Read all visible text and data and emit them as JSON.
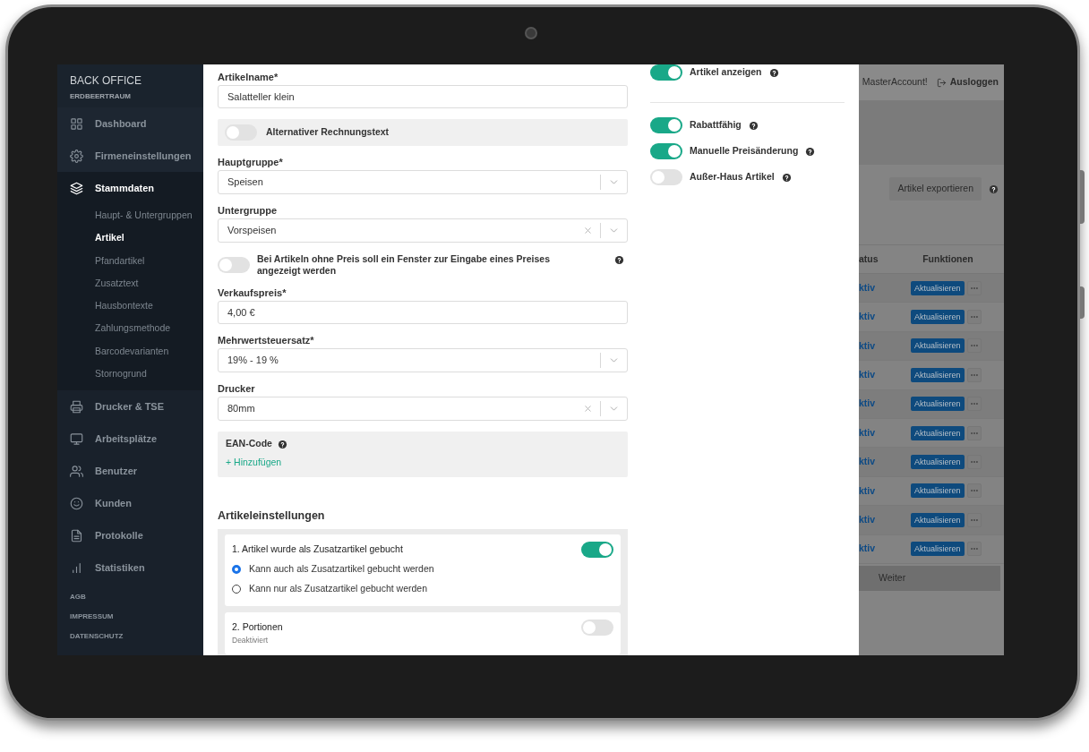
{
  "sidebar": {
    "title": "BACK OFFICE",
    "subtitle": "ERDBEERTRAUM",
    "items": [
      {
        "label": "Dashboard",
        "selected": false
      },
      {
        "label": "Firmeneinstellungen",
        "selected": false
      },
      {
        "label": "Stammdaten",
        "selected": true,
        "children": [
          {
            "label": "Haupt- & Untergruppen",
            "selected": false
          },
          {
            "label": "Artikel",
            "selected": true
          },
          {
            "label": "Pfandartikel",
            "selected": false
          },
          {
            "label": "Zusatztext",
            "selected": false
          },
          {
            "label": "Hausbontexte",
            "selected": false
          },
          {
            "label": "Zahlungsmethode",
            "selected": false
          },
          {
            "label": "Barcodevarianten",
            "selected": false
          },
          {
            "label": "Stornogrund",
            "selected": false
          }
        ]
      },
      {
        "label": "Drucker & TSE",
        "selected": false
      },
      {
        "label": "Arbeitsplätze",
        "selected": false
      },
      {
        "label": "Benutzer",
        "selected": false
      },
      {
        "label": "Kunden",
        "selected": false
      },
      {
        "label": "Protokolle",
        "selected": false
      },
      {
        "label": "Statistiken",
        "selected": false
      }
    ],
    "footer_links": [
      "AGB",
      "IMPRESSUM",
      "DATENSCHUTZ"
    ]
  },
  "dialog": {
    "fields": [
      {
        "kind": "input",
        "label": "Artikelname*",
        "value": "Salatteller klein"
      },
      {
        "kind": "toggle_box",
        "label": "Alternativer Rechnungstext",
        "on": false
      },
      {
        "kind": "select",
        "label": "Hauptgruppe*",
        "value": "Speisen",
        "clearable": false
      },
      {
        "kind": "select",
        "label": "Untergruppe",
        "value": "Vorspeisen",
        "clearable": true
      },
      {
        "kind": "toggle",
        "label": "Bei Artikeln ohne Preis soll ein Fenster zur Eingabe eines Preises angezeigt werden",
        "on": false,
        "help": true
      },
      {
        "kind": "input",
        "label": "Verkaufspreis*",
        "value": "4,00 €"
      },
      {
        "kind": "select",
        "label": "Mehrwertsteuersatz*",
        "value": "19% - 19 %",
        "clearable": false
      },
      {
        "kind": "select",
        "label": "Drucker",
        "value": "80mm",
        "clearable": true
      },
      {
        "kind": "ean",
        "label": "EAN-Code",
        "help": true,
        "link": "+ Hinzufügen"
      }
    ],
    "settings": {
      "heading": "Artikeleinstellungen",
      "cards": [
        {
          "title": "1. Artikel wurde als Zusatzartikel gebucht",
          "on": true,
          "options": [
            {
              "label": "Kann auch als Zusatzartikel gebucht werden",
              "selected": true
            },
            {
              "label": "Kann nur als Zusatzartikel gebucht werden",
              "selected": false
            }
          ]
        },
        {
          "title": "2. Portionen",
          "on": false,
          "subtitle": "Deaktiviert"
        }
      ]
    },
    "right_toggle_groups": [
      [
        {
          "label": "Artikel anzeigen",
          "on": true,
          "help": true
        }
      ],
      [
        {
          "label": "Rabattfähig",
          "on": true,
          "help": true
        },
        {
          "label": "Manuelle Preisänderung",
          "on": true,
          "help": true
        },
        {
          "label": "Außer-Haus Artikel",
          "on": false,
          "help": true
        }
      ]
    ]
  },
  "background": {
    "greeting": "MasterAccount!",
    "logout": "Ausloggen",
    "export_button": "Artikel exportieren",
    "table": {
      "columns": [
        "atus",
        "Funktionen"
      ],
      "rows": [
        {
          "status": "ktiv",
          "action": "Aktualisieren"
        },
        {
          "status": "ktiv",
          "action": "Aktualisieren"
        },
        {
          "status": "ktiv",
          "action": "Aktualisieren"
        },
        {
          "status": "ktiv",
          "action": "Aktualisieren"
        },
        {
          "status": "ktiv",
          "action": "Aktualisieren"
        },
        {
          "status": "ktiv",
          "action": "Aktualisieren"
        },
        {
          "status": "ktiv",
          "action": "Aktualisieren"
        },
        {
          "status": "ktiv",
          "action": "Aktualisieren"
        },
        {
          "status": "ktiv",
          "action": "Aktualisieren"
        },
        {
          "status": "ktiv",
          "action": "Aktualisieren"
        }
      ]
    },
    "next_button": "Weiter"
  }
}
